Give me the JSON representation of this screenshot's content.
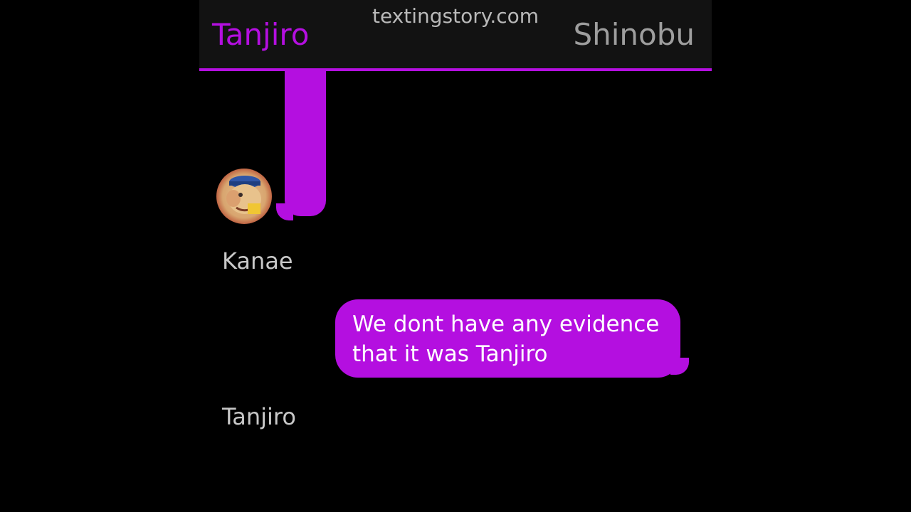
{
  "header": {
    "watermark": "textingstory.com",
    "left_contact": "Tanjiro",
    "right_contact": "Shinobu"
  },
  "conversation": {
    "first_sender_label": "Kanae",
    "message": {
      "text": "We dont have any evidence that it was Tanjiro"
    },
    "second_sender_label": "Tanjiro"
  },
  "colors": {
    "accent": "#b40fe0",
    "header_bg": "#121212",
    "background": "#000000",
    "label_text": "#c8c8c8",
    "inactive_contact": "#9e9e9e"
  },
  "icons": {
    "avatar": "cartoon-character-avatar"
  }
}
